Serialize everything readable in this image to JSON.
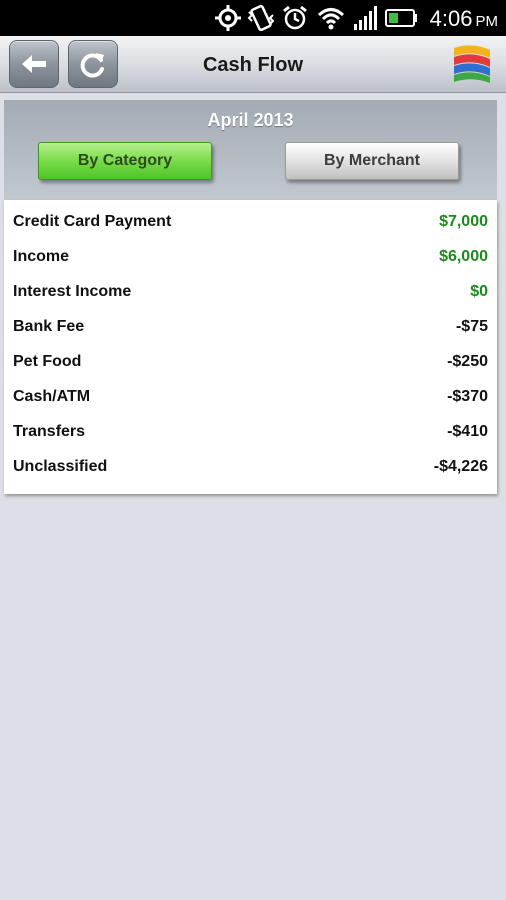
{
  "status_bar": {
    "time": "4:06",
    "ampm": "PM",
    "icons": [
      "gps-icon",
      "vibrate-icon",
      "alarm-icon",
      "wifi-icon",
      "signal-icon",
      "battery-icon"
    ]
  },
  "header": {
    "title": "Cash Flow",
    "back_icon": "back-arrow-icon",
    "refresh_icon": "refresh-icon",
    "logo_icon": "app-logo-icon"
  },
  "period": {
    "label": "April 2013"
  },
  "tabs": [
    {
      "label": "By Category",
      "active": true
    },
    {
      "label": "By Merchant",
      "active": false
    }
  ],
  "rows": [
    {
      "name": "Credit Card Payment",
      "amount": "$7,000",
      "positive": true
    },
    {
      "name": "Income",
      "amount": "$6,000",
      "positive": true
    },
    {
      "name": "Interest Income",
      "amount": "$0",
      "positive": true
    },
    {
      "name": "Bank Fee",
      "amount": "-$75",
      "positive": false
    },
    {
      "name": "Pet Food",
      "amount": "-$250",
      "positive": false
    },
    {
      "name": "Cash/ATM",
      "amount": "-$370",
      "positive": false
    },
    {
      "name": "Transfers",
      "amount": "-$410",
      "positive": false
    },
    {
      "name": "Unclassified",
      "amount": "-$4,226",
      "positive": false
    }
  ],
  "colors": {
    "positive": "#1d8a1d",
    "negative": "#111111",
    "active_tab": "#79dc4a"
  }
}
